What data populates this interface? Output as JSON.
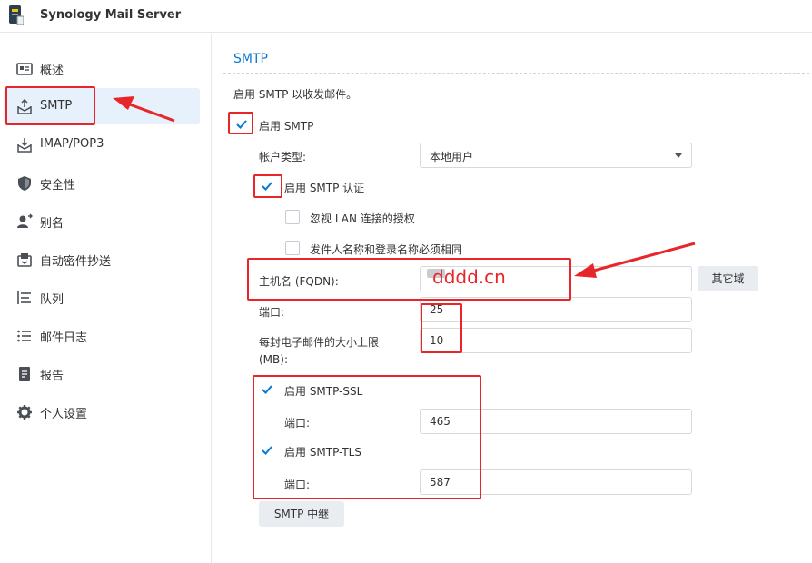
{
  "app": {
    "title": "Synology Mail Server",
    "icon": "synology-mail-server-icon"
  },
  "sidebar": {
    "items": [
      {
        "label": "概述",
        "icon": "overview-icon"
      },
      {
        "label": "SMTP",
        "icon": "smtp-icon",
        "active": true
      },
      {
        "label": "IMAP/POP3",
        "icon": "imap-pop3-icon"
      },
      {
        "label": "安全性",
        "icon": "security-shield-icon"
      },
      {
        "label": "别名",
        "icon": "alias-user-icon"
      },
      {
        "label": "自动密件抄送",
        "icon": "auto-bcc-icon"
      },
      {
        "label": "队列",
        "icon": "queue-list-icon"
      },
      {
        "label": "邮件日志",
        "icon": "mail-log-icon"
      },
      {
        "label": "报告",
        "icon": "report-icon"
      },
      {
        "label": "个人设置",
        "icon": "gear-icon"
      }
    ]
  },
  "smtp": {
    "section_title": "SMTP",
    "description": "启用 SMTP 以收发邮件。",
    "enable_smtp": {
      "label": "启用 SMTP",
      "checked": true
    },
    "account_type": {
      "label": "帐户类型:",
      "value": "本地用户"
    },
    "enable_auth": {
      "label": "启用 SMTP 认证",
      "checked": true
    },
    "ignore_lan": {
      "label": "忽视 LAN 连接的授权",
      "checked": false
    },
    "sender_match": {
      "label": "发件人名称和登录名称必须相同",
      "checked": false
    },
    "hostname": {
      "label": "主机名 (FQDN):",
      "value": "",
      "overlay": "dddd.cn"
    },
    "other_domains_button": "其它域",
    "port": {
      "label": "端口:",
      "value": "25"
    },
    "max_size": {
      "label": "每封电子邮件的大小上限",
      "label_unit": "(MB):",
      "value": "10"
    },
    "ssl": {
      "label": "启用 SMTP-SSL",
      "checked": true,
      "port_label": "端口:",
      "port": "465"
    },
    "tls": {
      "label": "启用 SMTP-TLS",
      "checked": true,
      "port_label": "端口:",
      "port": "587"
    },
    "relay_button": "SMTP 中继"
  },
  "colors": {
    "accent": "#0b78d1",
    "annotation_red": "#e8262a",
    "active_nav_bg": "#e6f1fb"
  }
}
